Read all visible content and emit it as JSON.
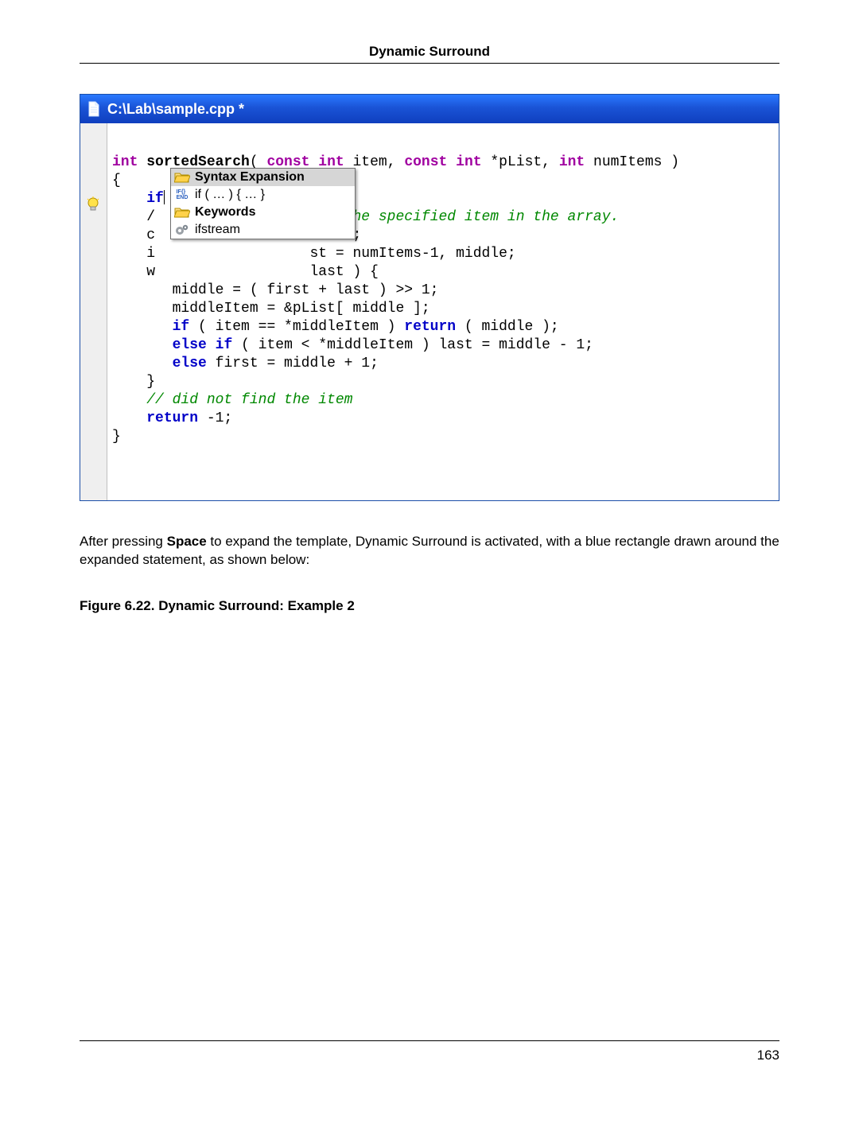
{
  "header": {
    "title": "Dynamic Surround"
  },
  "editor": {
    "titlebar": {
      "path": "C:\\Lab\\sample.cpp *"
    },
    "code": {
      "kw_int": "int",
      "fn": "sortedSearch",
      "kw_const1": "const",
      "kw_int2": "int",
      "p_item": "item,",
      "kw_const2": "const",
      "kw_int3": "int",
      "p_plist": "*pList,",
      "kw_int4": "int",
      "p_num": "numItems )",
      "brace_open": "{",
      "kw_if": "if",
      "frag_slash": "/",
      "cmt_tail": "for the specified item in the array.",
      "frag_c": "c",
      "partial_eitem": "eItem;",
      "frag_i": "i",
      "partial_st": "st = numItems-1, middle;",
      "frag_w": "w",
      "partial_last": "last ) {",
      "line_mid1": "middle = ( first + last ) >> 1;",
      "line_mid2": "middleItem = &pList[ middle ];",
      "kw_if2": "if",
      "cond1": " ( item == *middleItem ) ",
      "kw_return1": "return",
      "ret1_tail": " ( middle );",
      "kw_else1": "else",
      "kw_if3": "if",
      "cond2": " ( item < *middleItem ) last = middle - 1;",
      "kw_else2": "else",
      "else2_tail": " first = middle + 1;",
      "brace_close_inner": "}",
      "cmt2": "// did not find the item",
      "kw_return2": "return",
      "ret2_tail": " -1;",
      "brace_close_outer": "}"
    }
  },
  "popup": {
    "items": [
      {
        "label": "Syntax Expansion",
        "icon": "folder"
      },
      {
        "label": "if ( … ) { … }",
        "icon": "ifend"
      },
      {
        "label": "Keywords",
        "icon": "folder"
      },
      {
        "label": "ifstream",
        "icon": "gears"
      }
    ]
  },
  "body": {
    "para_pre": "After pressing ",
    "para_bold": "Space",
    "para_post": " to expand the template, Dynamic Surround is activated, with a blue rectangle drawn around the expanded statement, as shown below:",
    "fig_caption": "Figure 6.22. Dynamic Surround: Example 2"
  },
  "footer": {
    "page": "163"
  }
}
